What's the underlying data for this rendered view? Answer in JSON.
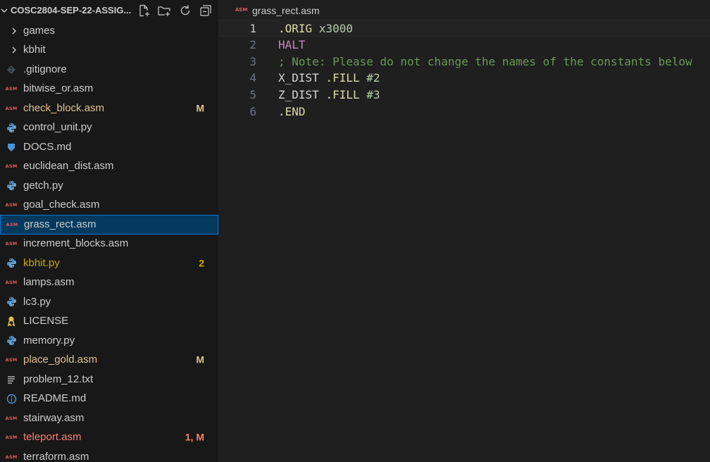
{
  "explorer": {
    "project_title": "COSC2804-SEP-22-ASSIG...",
    "actions": [
      "new-file-icon",
      "new-folder-icon",
      "refresh-icon",
      "collapse-all-icon"
    ]
  },
  "files": [
    {
      "name": "games",
      "icon": "chevron-right-icon",
      "kind": "folder",
      "status": "",
      "badge": ""
    },
    {
      "name": "kbhit",
      "icon": "chevron-right-icon",
      "kind": "folder",
      "status": "",
      "badge": ""
    },
    {
      "name": ".gitignore",
      "icon": "git-icon",
      "kind": "git",
      "status": "",
      "badge": ""
    },
    {
      "name": "bitwise_or.asm",
      "icon": "asm-icon",
      "kind": "asm",
      "status": "",
      "badge": ""
    },
    {
      "name": "check_block.asm",
      "icon": "asm-icon",
      "kind": "asm",
      "status": "modified",
      "badge": "M"
    },
    {
      "name": "control_unit.py",
      "icon": "python-icon",
      "kind": "py",
      "status": "",
      "badge": ""
    },
    {
      "name": "DOCS.md",
      "icon": "markdown-download-icon",
      "kind": "md",
      "status": "",
      "badge": ""
    },
    {
      "name": "euclidean_dist.asm",
      "icon": "asm-icon",
      "kind": "asm",
      "status": "",
      "badge": ""
    },
    {
      "name": "getch.py",
      "icon": "python-icon",
      "kind": "py",
      "status": "",
      "badge": ""
    },
    {
      "name": "goal_check.asm",
      "icon": "asm-icon",
      "kind": "asm",
      "status": "",
      "badge": ""
    },
    {
      "name": "grass_rect.asm",
      "icon": "asm-icon",
      "kind": "asm",
      "status": "selected",
      "badge": ""
    },
    {
      "name": "increment_blocks.asm",
      "icon": "asm-icon",
      "kind": "asm",
      "status": "",
      "badge": ""
    },
    {
      "name": "kbhit.py",
      "icon": "python-icon",
      "kind": "py",
      "status": "warn",
      "badge": "2"
    },
    {
      "name": "lamps.asm",
      "icon": "asm-icon",
      "kind": "asm",
      "status": "",
      "badge": ""
    },
    {
      "name": "lc3.py",
      "icon": "python-icon",
      "kind": "py",
      "status": "",
      "badge": ""
    },
    {
      "name": "LICENSE",
      "icon": "license-icon",
      "kind": "license",
      "status": "",
      "badge": ""
    },
    {
      "name": "memory.py",
      "icon": "python-icon",
      "kind": "py",
      "status": "",
      "badge": ""
    },
    {
      "name": "place_gold.asm",
      "icon": "asm-icon",
      "kind": "asm",
      "status": "modified",
      "badge": "M"
    },
    {
      "name": "problem_12.txt",
      "icon": "text-lines-icon",
      "kind": "txt",
      "status": "",
      "badge": ""
    },
    {
      "name": "README.md",
      "icon": "info-icon",
      "kind": "info",
      "status": "",
      "badge": ""
    },
    {
      "name": "stairway.asm",
      "icon": "asm-icon",
      "kind": "asm",
      "status": "",
      "badge": ""
    },
    {
      "name": "teleport.asm",
      "icon": "asm-icon",
      "kind": "asm",
      "status": "err",
      "badge": "1, M"
    },
    {
      "name": "terraform.asm",
      "icon": "asm-icon",
      "kind": "asm",
      "status": "",
      "badge": ""
    }
  ],
  "asm_icon_text": "ASM",
  "editor": {
    "tab_title": "grass_rect.asm",
    "lines": [
      {
        "num": "1",
        "tokens": [
          {
            "t": ".ORIG",
            "c": "kw"
          },
          {
            "t": " ",
            "c": "plain"
          },
          {
            "t": "x3000",
            "c": "num"
          }
        ]
      },
      {
        "num": "2",
        "tokens": [
          {
            "t": "HALT",
            "c": "halt"
          }
        ]
      },
      {
        "num": "3",
        "tokens": [
          {
            "t": "; Note: Please do not change the names of the constants below",
            "c": "cmt"
          }
        ]
      },
      {
        "num": "4",
        "tokens": [
          {
            "t": "X_DIST ",
            "c": "plain"
          },
          {
            "t": ".FILL",
            "c": "kw"
          },
          {
            "t": " ",
            "c": "plain"
          },
          {
            "t": "#2",
            "c": "num"
          }
        ]
      },
      {
        "num": "5",
        "tokens": [
          {
            "t": "Z_DIST ",
            "c": "plain"
          },
          {
            "t": ".FILL",
            "c": "kw"
          },
          {
            "t": " ",
            "c": "plain"
          },
          {
            "t": "#3",
            "c": "num"
          }
        ]
      },
      {
        "num": "6",
        "tokens": [
          {
            "t": ".END",
            "c": "kw"
          }
        ]
      }
    ],
    "current_line": 1
  },
  "colors": {
    "modified": "#e2c08d",
    "warning": "#cca700",
    "error": "#f88070",
    "selection": "#04395e",
    "focus_border": "#0078d4"
  }
}
